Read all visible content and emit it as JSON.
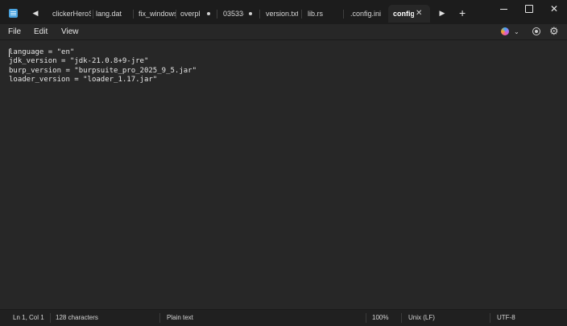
{
  "window": {
    "tabs": [
      {
        "label": "clickerHeroS",
        "modified": false,
        "active": false
      },
      {
        "label": "lang.dat",
        "modified": false,
        "active": false
      },
      {
        "label": "fix_windows",
        "modified": false,
        "active": false
      },
      {
        "label": "overpl",
        "modified": true,
        "active": false
      },
      {
        "label": "03533-",
        "modified": true,
        "active": false
      },
      {
        "label": "version.txt",
        "modified": false,
        "active": false
      },
      {
        "label": "lib.rs",
        "modified": false,
        "active": false
      },
      {
        "label": ".config.ini",
        "modified": false,
        "active": false
      },
      {
        "label": "config",
        "modified": false,
        "active": true
      }
    ],
    "tab_close_glyph": "✕",
    "new_tab_glyph": "+",
    "close_glyph": "✕"
  },
  "menu": {
    "file": "File",
    "edit": "Edit",
    "view": "View"
  },
  "editor": {
    "lines": [
      "language = \"en\"",
      "jdk_version = \"jdk-21.0.8+9-jre\"",
      "burp_version = \"burpsuite_pro_2025_9_5.jar\"",
      "loader_version = \"loader_1.17.jar\""
    ]
  },
  "status": {
    "position": "Ln 1, Col 1",
    "characters": "128 characters",
    "format": "Plain text",
    "zoom": "100%",
    "line_ending": "Unix (LF)",
    "encoding": "UTF-8"
  },
  "colors": {
    "background": "#272727",
    "titlebar": "#1c1c1c",
    "statusbar": "#202020",
    "text": "#e6e6e6",
    "app_icon": "#4aa3df"
  },
  "icons": {
    "app": "notepad-icon",
    "tab_scroll_left": "caret-left-icon",
    "tab_scroll_right": "caret-right-icon",
    "copilot": "copilot-icon",
    "account": "account-icon",
    "settings": "gear-icon"
  }
}
